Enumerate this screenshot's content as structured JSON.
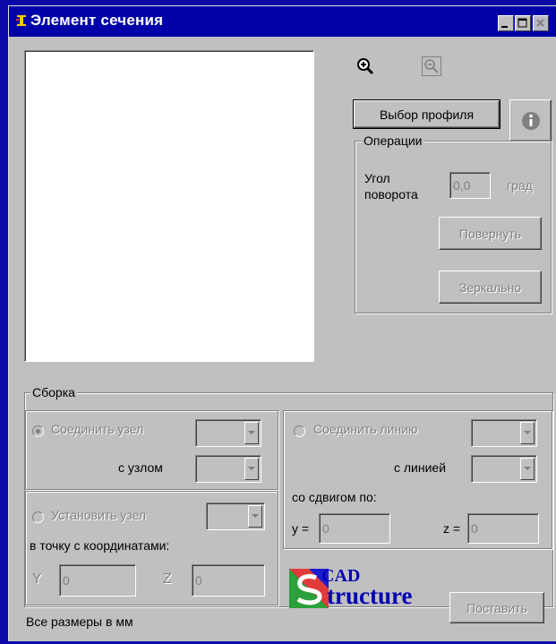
{
  "window": {
    "title": "Элемент сечения",
    "minimize_icon": "minimize-icon",
    "maximize_icon": "maximize-icon",
    "close_icon": "close-icon"
  },
  "toolbar": {
    "zoom_in_icon": "zoom-in-icon",
    "zoom_out_icon": "zoom-out-icon",
    "profile_button": "Выбор профиля",
    "info_icon": "info-icon"
  },
  "operations": {
    "group_label": "Операции",
    "angle_label_1": "Угол",
    "angle_label_2": "поворота",
    "angle_value": "0,0",
    "angle_unit": "град",
    "rotate_button": "Повернуть",
    "mirror_button": "Зеркально"
  },
  "assembly": {
    "group_label": "Сборка",
    "connect_node": "Соединить узел",
    "with_node": "с узлом",
    "set_node": "Установить узел",
    "to_point": "в точку с координатами:",
    "y_label": "Y",
    "y_value": "0",
    "z_label": "Z",
    "z_value": "0",
    "connect_line": "Соединить линию",
    "with_line": "с линией",
    "offset_label": "со сдвигом по:",
    "y_offset_label": "y =",
    "y_offset_value": "0",
    "z_offset_label": "z =",
    "z_offset_value": "0"
  },
  "footer": {
    "units_note": "Все размеры в  мм",
    "logo_text_1": "CAD",
    "logo_text_2": "tructure",
    "place_button": "Поставить"
  },
  "colors": {
    "desktop": "#0b0aa8",
    "titlebar": "#0000a8",
    "face": "#c0c0c0"
  }
}
